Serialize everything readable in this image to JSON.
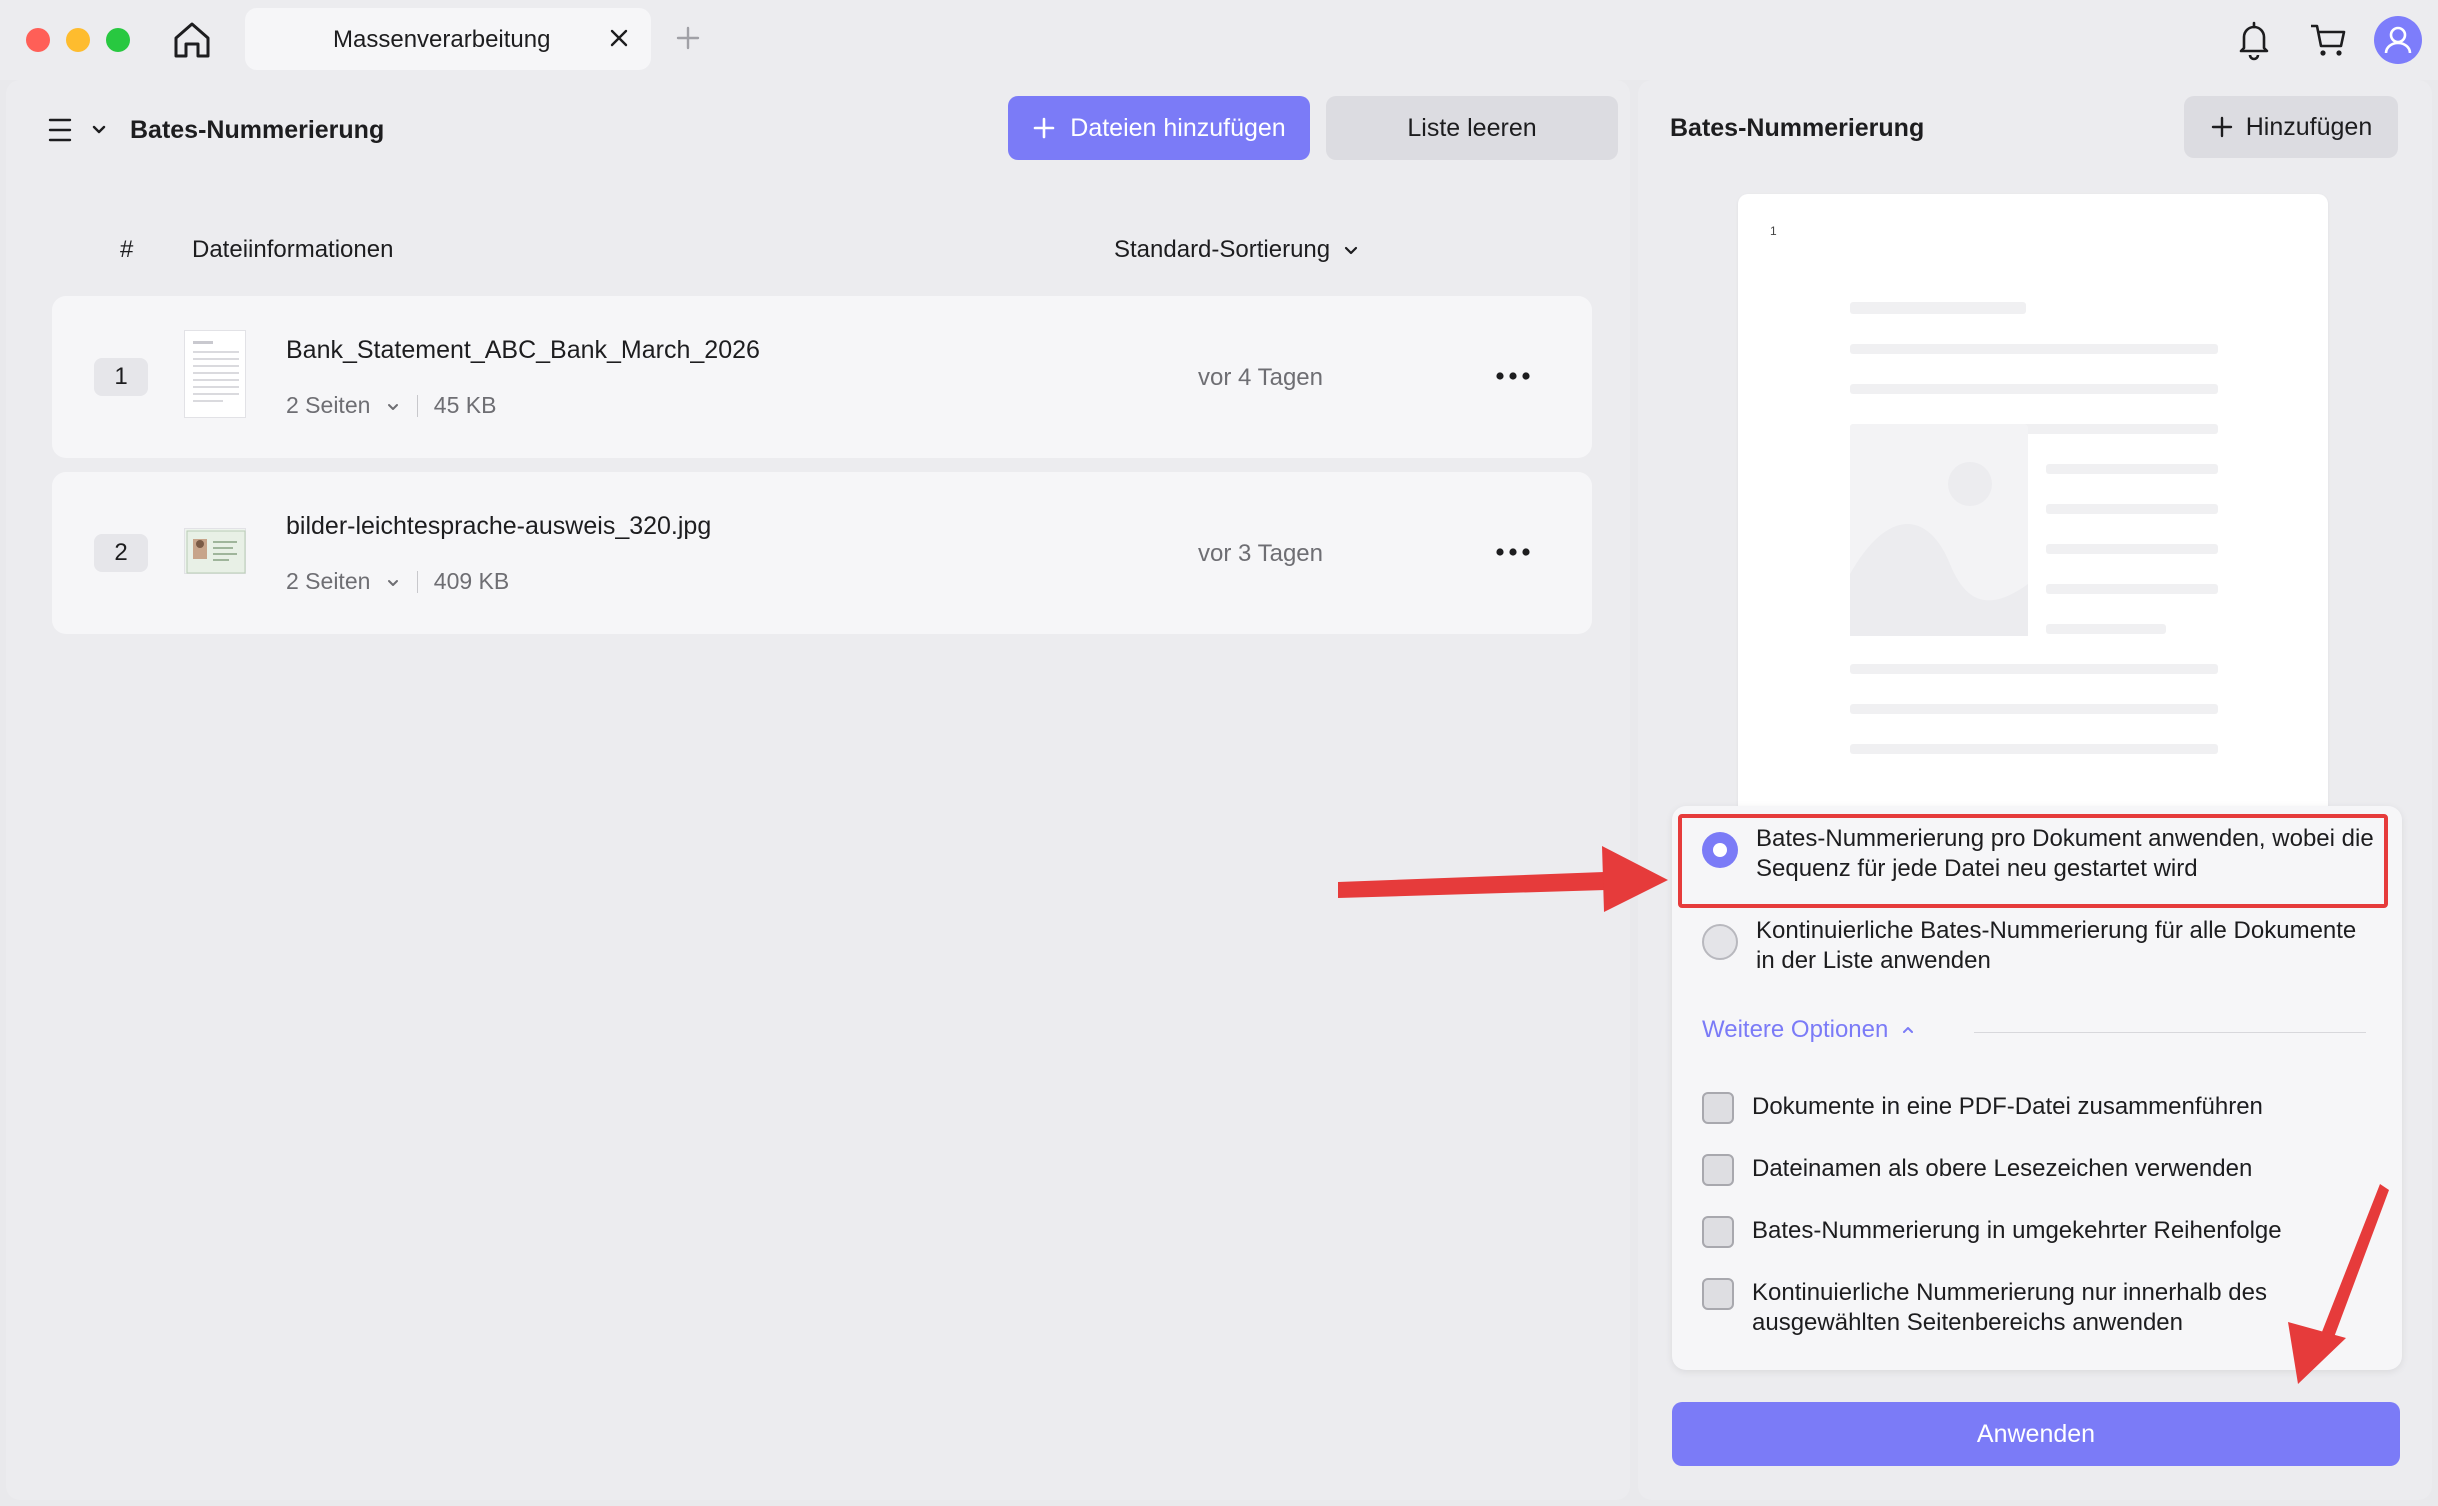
{
  "titlebar": {
    "tab_title": "Massenverarbeitung"
  },
  "left": {
    "title": "Bates-Nummerierung",
    "add_files_label": "Dateien hinzufügen",
    "clear_list_label": "Liste leeren",
    "columns": {
      "hash": "#",
      "info": "Dateiinformationen",
      "sort": "Standard-Sortierung"
    },
    "files": [
      {
        "number": "1",
        "name": "Bank_Statement_ABC_Bank_March_2026",
        "pages": "2 Seiten",
        "size": "45 KB",
        "date": "vor 4 Tagen"
      },
      {
        "number": "2",
        "name": "bilder-leichtesprache-ausweis_320.jpg",
        "pages": "2 Seiten",
        "size": "409 KB",
        "date": "vor 3 Tagen"
      }
    ]
  },
  "right": {
    "title": "Bates-Nummerierung",
    "add_label": "Hinzufügen",
    "preview_page_number": "1",
    "radio_options": [
      {
        "label": "Bates-Nummerierung pro Dokument anwenden, wobei die Sequenz für jede Datei neu gestartet wird",
        "selected": true
      },
      {
        "label": "Kontinuierliche Bates-Nummerierung für alle Dokumente in der Liste anwenden",
        "selected": false
      }
    ],
    "more_options_label": "Weitere Optionen",
    "checkboxes": [
      {
        "label": "Dokumente in eine PDF-Datei zusammenführen",
        "checked": false
      },
      {
        "label": "Dateinamen als obere Lesezeichen verwenden",
        "checked": false
      },
      {
        "label": "Bates-Nummerierung in umgekehrter Reihenfolge",
        "checked": false
      },
      {
        "label": "Kontinuierliche Nummerierung nur innerhalb des ausgewählten Seitenbereichs anwenden",
        "checked": false
      }
    ],
    "apply_label": "Anwenden"
  },
  "colors": {
    "accent": "#7b7bf7",
    "annotation": "#e63b3b"
  }
}
